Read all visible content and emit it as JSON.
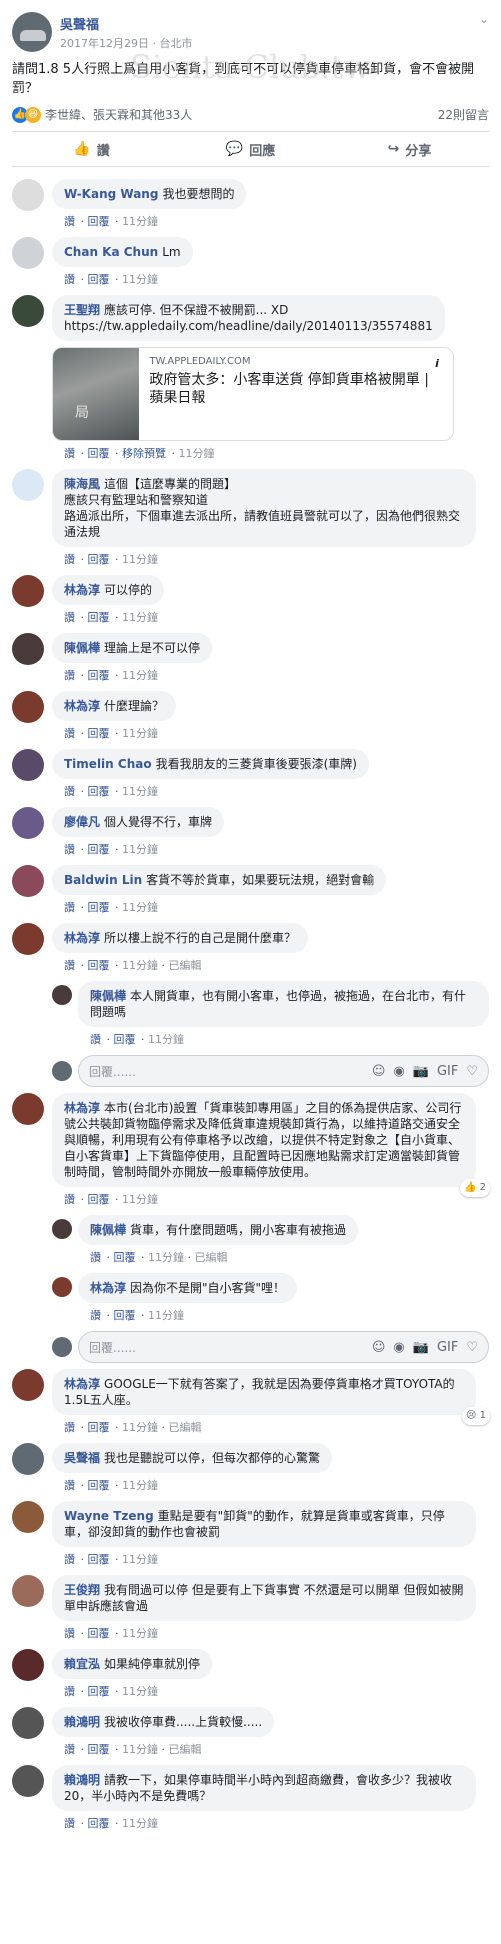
{
  "post": {
    "author": "吳聲福",
    "date": "2017年12月29日",
    "location": "台北市",
    "text": "請問1.8 5人行照上爲自用小客貨，到底可不可以停貨車停車格卸貨，會不會被開罰？",
    "watermark": "Sienta-Club.tw",
    "reactions_text": "李世緯、張天霖和其他33人",
    "comments_count": "22則留言"
  },
  "actions": {
    "like": "讚",
    "comment": "回應",
    "share": "分享"
  },
  "link_preview": {
    "domain": "TW.APPLEDAILY.COM",
    "title": "政府管太多：小客車送貨 停卸貨車格被開單 | 蘋果日報",
    "image_text": "局"
  },
  "comments": [
    {
      "name": "W-Kang Wang",
      "text": "我也要想問的",
      "links": [
        "讚",
        "回覆"
      ],
      "time": "11分鐘",
      "color": "#ddd"
    },
    {
      "name": "Chan Ka Chun",
      "text": "Lm",
      "links": [
        "讚",
        "回覆"
      ],
      "time": "11分鐘",
      "color": "#cfd2d6"
    },
    {
      "name": "王聖翔",
      "text": "應該可停. 但不保證不被開罰... XD\nhttps://tw.appledaily.com/headline/daily/20140113/35574881",
      "links": [
        "讚",
        "回覆",
        "移除預覽"
      ],
      "time": "11分鐘",
      "color": "#3a4a3a"
    },
    {
      "name": "陳海風",
      "text": "這個【這麼專業的問題】\n應該只有監理站和警察知道\n路過派出所，下個車進去派出所，請教值班員警就可以了，因為他們很熟交通法規",
      "links": [
        "讚",
        "回覆"
      ],
      "time": "11分鐘",
      "color": "#dbe8f5"
    },
    {
      "name": "林為淳",
      "text": "可以停的",
      "links": [
        "讚",
        "回覆"
      ],
      "time": "11分鐘",
      "color": "#7a3b2e"
    },
    {
      "name": "陳佩樺",
      "text": "理論上是不可以停",
      "links": [
        "讚",
        "回覆"
      ],
      "time": "11分鐘",
      "color": "#4a3b3b"
    },
    {
      "name": "林為淳",
      "text": "什麼理論？",
      "links": [
        "讚",
        "回覆"
      ],
      "time": "11分鐘",
      "color": "#7a3b2e"
    },
    {
      "name": "Timelin Chao",
      "text": "我看我朋友的三菱貨車後要張漆(車牌)",
      "links": [
        "讚",
        "回覆"
      ],
      "time": "11分鐘",
      "color": "#5a4a6a"
    },
    {
      "name": "廖偉凡",
      "text": "個人覺得不行，車牌",
      "links": [
        "讚",
        "回覆"
      ],
      "time": "11分鐘",
      "color": "#6a5a8a"
    },
    {
      "name": "Baldwin Lin",
      "text": "客貨不等於貨車，如果要玩法規，絕對會輸",
      "links": [
        "讚",
        "回覆"
      ],
      "time": "11分鐘",
      "color": "#8a4a5a"
    },
    {
      "name": "林為淳",
      "text": "所以樓上說不行的自己是開什麼車？",
      "links": [
        "讚",
        "回覆"
      ],
      "time": "11分鐘",
      "edited": "已編輯",
      "color": "#7a3b2e"
    },
    {
      "name": "陳佩樺",
      "text": "本人開貨車，也有開小客車，也停過，被拖過，在台北市，有什問題嗎",
      "links": [
        "讚",
        "回覆"
      ],
      "time": "11分鐘",
      "color": "#4a3b3b"
    },
    {
      "name": "林為淳",
      "text": "本市(台北市)設置「貨車裝卸專用區」之目的係為提供店家、公司行號公共裝卸貨物臨停需求及降低貨車違規裝卸貨行為，以維持道路交通安全與順暢，利用現有公有停車格予以改繪，以提供不特定對象之【自小貨車、自小客貨車】上下貨臨停使用，且配置時已因應地點需求訂定適當裝卸貨管制時間，管制時間外亦開放一般車輛停放使用。",
      "links": [
        "讚",
        "回覆"
      ],
      "time": "11分鐘",
      "reaction": "2",
      "color": "#7a3b2e"
    },
    {
      "name": "陳佩樺",
      "text": "貨車，有什麼問題嗎，開小客車有被拖過",
      "links": [
        "讚",
        "回覆"
      ],
      "time": "11分鐘",
      "edited": "已編輯",
      "color": "#4a3b3b"
    },
    {
      "name": "林為淳",
      "text": "因為你不是開\"自小客貨\"哩！",
      "links": [
        "讚",
        "回覆"
      ],
      "time": "11分鐘",
      "color": "#7a3b2e"
    },
    {
      "name": "林為淳",
      "text": "GOOGLE一下就有答案了，我就是因為要停貨車格才買TOYOTA的1.5L五人座。",
      "links": [
        "讚",
        "回覆"
      ],
      "time": "11分鐘",
      "edited": "已編輯",
      "reaction": "1",
      "color": "#7a3b2e"
    },
    {
      "name": "吳聲福",
      "text": "我也是聽說可以停，但每次都停的心驚驚",
      "links": [
        "讚",
        "回覆"
      ],
      "time": "11分鐘",
      "color": "#5f6a72"
    },
    {
      "name": "Wayne Tzeng",
      "text": "重點是要有\"卸貨\"的動作，就算是貨車或客貨車，只停車，卻沒卸貨的動作也會被罰",
      "links": [
        "讚",
        "回覆"
      ],
      "time": "11分鐘",
      "color": "#8a5a3a"
    },
    {
      "name": "王俊翔",
      "text": "我有問過可以停 但是要有上下貨事實 不然還是可以開單 但假如被開單申訴應該會過",
      "links": [
        "讚",
        "回覆"
      ],
      "time": "11分鐘",
      "color": "#9a6a5a"
    },
    {
      "name": "賴宜泓",
      "text": "如果純停車就別停",
      "links": [
        "讚",
        "回覆"
      ],
      "time": "11分鐘",
      "color": "#5a2a2a"
    },
    {
      "name": "賴鴻明",
      "text": "我被收停車費.....上貨較慢.....",
      "links": [
        "讚",
        "回覆"
      ],
      "time": "11分鐘",
      "edited": "已編輯",
      "color": "#555"
    },
    {
      "name": "賴鴻明",
      "text": "請教一下，如果停車時間半小時內到超商繳費，會收多少？我被收20，半小時內不是免費嗎？",
      "links": [
        "讚",
        "回覆"
      ],
      "time": "11分鐘",
      "color": "#555"
    }
  ],
  "reply_placeholder": "回覆......",
  "reply_icons": [
    "☺",
    "◉",
    "📷",
    "GIF",
    "♡"
  ]
}
